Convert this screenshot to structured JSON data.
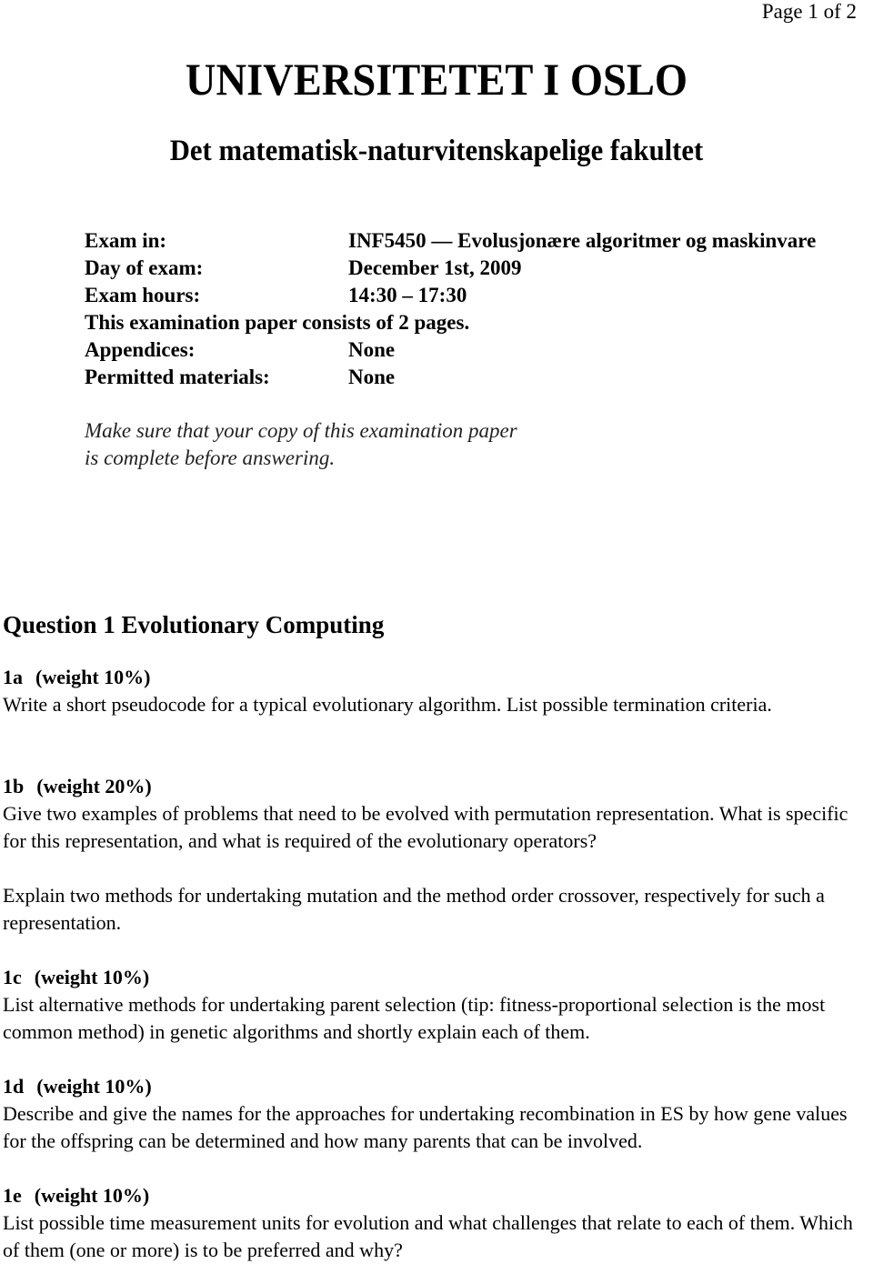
{
  "page_indicator": "Page 1 of 2",
  "university": "UNIVERSITETET I OSLO",
  "faculty": "Det matematisk-naturvitenskapelige fakultet",
  "exam_info": {
    "exam_in_label": "Exam in:",
    "exam_in_value": "INF5450 — Evolusjonære algoritmer og maskinvare",
    "day_label": "Day of exam:",
    "day_value": "December 1st, 2009",
    "hours_label": "Exam hours:",
    "hours_value": "14:30 – 17:30",
    "pages_note": "This examination paper consists of 2 pages.",
    "appendices_label": "Appendices:",
    "appendices_value": "None",
    "materials_label": "Permitted materials:",
    "materials_value": "None"
  },
  "notice": {
    "line1": "Make sure that your copy of this examination paper",
    "line2": "is complete before answering."
  },
  "question": {
    "title": "Question 1 Evolutionary Computing",
    "parts": [
      {
        "id": "1a",
        "weight": "(weight 10%)",
        "paragraphs": [
          "Write a short pseudocode for a typical evolutionary algorithm. List possible termination criteria."
        ]
      },
      {
        "id": "1b",
        "weight": "(weight 20%)",
        "paragraphs": [
          "Give two examples of problems that need to be evolved with permutation representation. What is specific for this representation, and what is required of the evolutionary operators?",
          "Explain two methods for undertaking mutation and the method order crossover, respectively for such a representation."
        ]
      },
      {
        "id": "1c",
        "weight": "(weight 10%)",
        "paragraphs": [
          "List alternative methods for undertaking parent selection (tip: fitness-proportional selection is the most common method) in genetic algorithms and shortly explain each of them."
        ]
      },
      {
        "id": "1d",
        "weight": "(weight 10%)",
        "paragraphs": [
          "Describe and give the names for the approaches for undertaking recombination in ES by how gene values for the offspring can be determined and how many parents that can be involved."
        ]
      },
      {
        "id": "1e",
        "weight": "(weight 10%)",
        "paragraphs": [
          "List possible time measurement units for evolution and what challenges that relate to each of them. Which of them (one or more) is to be preferred and why?"
        ]
      }
    ]
  }
}
